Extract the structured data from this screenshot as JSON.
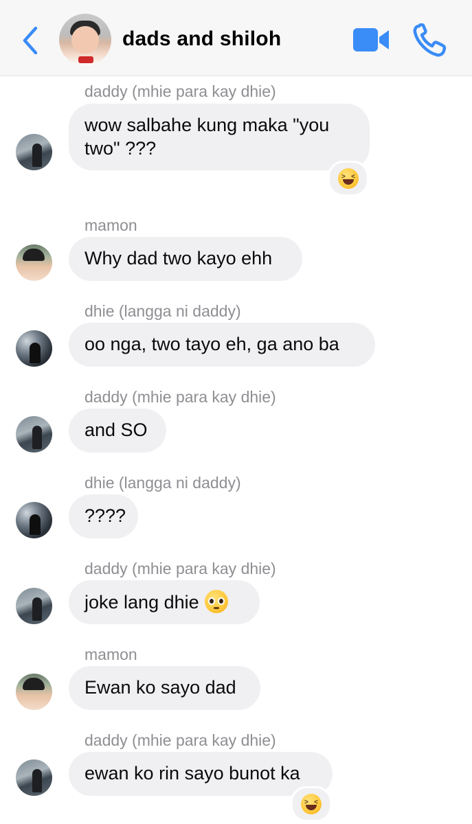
{
  "header": {
    "title": "dads and shiloh",
    "back_icon": "chevron-left-icon",
    "video_icon": "video-camera-icon",
    "call_icon": "phone-icon",
    "accent_color": "#3a8cf6"
  },
  "messages": [
    {
      "sender": "daddy (mhie para kay dhie)",
      "text": "wow salbahe kung maka \"you two\" ???",
      "reaction": "grinning-squinting-face"
    },
    {
      "sender": "mamon",
      "text": "Why dad two kayo ehh"
    },
    {
      "sender": "dhie (langga ni daddy)",
      "text": "oo nga, two tayo eh, ga ano ba"
    },
    {
      "sender": "daddy (mhie para kay dhie)",
      "text": "and SO"
    },
    {
      "sender": "dhie (langga ni daddy)",
      "text": "????"
    },
    {
      "sender": "daddy (mhie para kay dhie)",
      "text": "joke lang dhie",
      "inline_emoji": "pleading-face"
    },
    {
      "sender": "mamon",
      "text": "Ewan ko sayo dad"
    },
    {
      "sender": "daddy (mhie para kay dhie)",
      "text": "ewan ko rin sayo bunot ka",
      "reaction": "grinning-squinting-face"
    }
  ]
}
